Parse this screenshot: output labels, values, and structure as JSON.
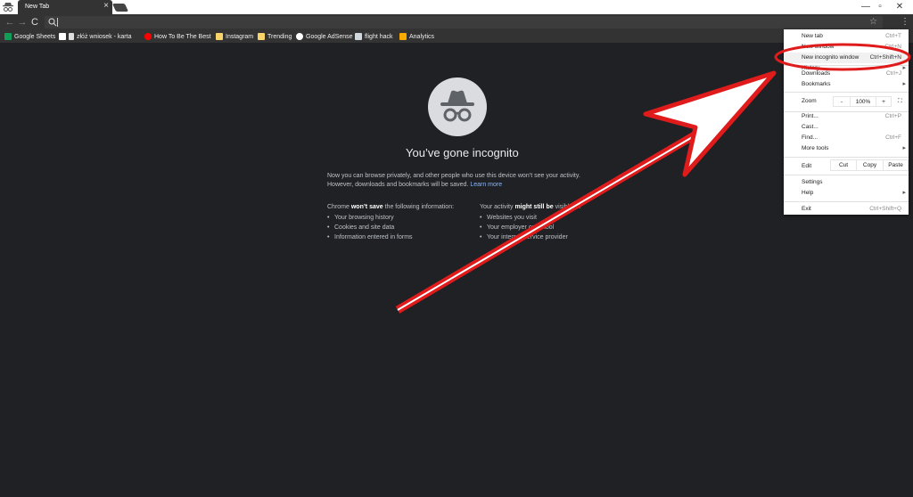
{
  "tab": {
    "title": "New Tab",
    "close": "×"
  },
  "window_controls": {
    "minimize": "—",
    "maximize": "▫",
    "close": "✕"
  },
  "toolbar": {
    "back": "←",
    "forward": "→",
    "reload": "C",
    "star": "☆",
    "menu": "⋮"
  },
  "bookmarks": [
    {
      "label": "Google Sheets",
      "color": "#0f9d58"
    },
    {
      "label": "złóż wniosek - karta",
      "color": "#ffffff"
    },
    {
      "label": "How To Be The Best",
      "color": "#ff0000"
    },
    {
      "label": "Instagram",
      "color": "#f6d36b"
    },
    {
      "label": "Trending",
      "color": "#f6d36b"
    },
    {
      "label": "Google AdSense",
      "color": "#ffffff"
    },
    {
      "label": "flight hack",
      "color": "#cfd8dc"
    },
    {
      "label": "Analytics",
      "color": "#f9ab00"
    }
  ],
  "incognito": {
    "heading": "You’ve gone incognito",
    "intro": "Now you can browse privately, and other people who use this device won’t see your activity. However, downloads and bookmarks will be saved.",
    "learn_more": "Learn more",
    "col1_prefix": "Chrome",
    "col1_bold": "won’t save",
    "col1_suffix": "the following information:",
    "col1_items": [
      "Your browsing history",
      "Cookies and site data",
      "Information entered in forms"
    ],
    "col2_prefix": "Your activity",
    "col2_bold": "might still be",
    "col2_suffix": "visible to:",
    "col2_items": [
      "Websites you visit",
      "Your employer or school",
      "Your internet service provider"
    ]
  },
  "menu": {
    "new_tab": "New tab",
    "new_tab_sc": "Ctrl+T",
    "new_window": "New window",
    "new_window_sc": "Ctrl+N",
    "new_incognito": "New incognito window",
    "new_incognito_sc": "Ctrl+Shift+N",
    "history": "History",
    "downloads": "Downloads",
    "downloads_sc": "Ctrl+J",
    "bookmarks": "Bookmarks",
    "zoom": "Zoom",
    "zoom_minus": "-",
    "zoom_value": "100%",
    "zoom_plus": "+",
    "fullscreen": "⛶",
    "print": "Print...",
    "print_sc": "Ctrl+P",
    "cast": "Cast...",
    "find": "Find...",
    "find_sc": "Ctrl+F",
    "more_tools": "More tools",
    "edit": "Edit",
    "cut": "Cut",
    "copy": "Copy",
    "paste": "Paste",
    "settings": "Settings",
    "help": "Help",
    "exit": "Exit",
    "exit_sc": "Ctrl+Shift+Q",
    "submenu_arrow": "▸"
  },
  "colors": {
    "annotation_red": "#e01b1b",
    "accent_link": "#8ab4f8",
    "page_bg": "#202124"
  }
}
